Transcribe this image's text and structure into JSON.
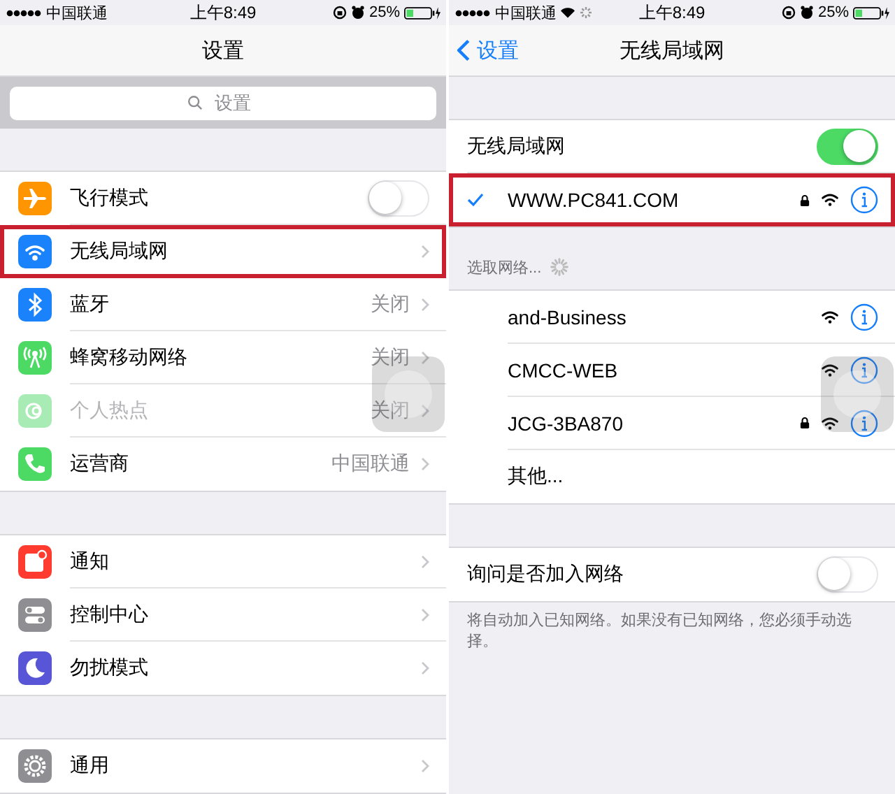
{
  "settings_screen": {
    "status_bar": {
      "carrier": "中国联通",
      "time": "上午8:49",
      "battery": "25%"
    },
    "nav": {
      "title": "设置"
    },
    "search": {
      "placeholder": "设置"
    },
    "groups": [
      [
        {
          "color": "#ff9500",
          "label": "飞行模式",
          "kind": "toggle",
          "on": false,
          "disabled": false,
          "highlighted": false
        },
        {
          "color": "#1a82fb",
          "label": "无线局域网",
          "kind": "link",
          "disabled": false,
          "highlighted": true
        },
        {
          "color": "#1a82fb",
          "label": "蓝牙",
          "value": "关闭",
          "kind": "link",
          "disabled": false,
          "highlighted": false
        },
        {
          "color": "#4cd964",
          "label": "蜂窝移动网络",
          "value": "关闭",
          "kind": "link",
          "disabled": false,
          "highlighted": false
        },
        {
          "color": "#a8ebb5",
          "label": "个人热点",
          "value": "关闭",
          "kind": "link",
          "disabled": true,
          "highlighted": false
        },
        {
          "color": "#4cd964",
          "label": "运营商",
          "value": "中国联通",
          "kind": "link",
          "disabled": false,
          "highlighted": false
        }
      ],
      [
        {
          "color": "#ff3b30",
          "label": "通知",
          "kind": "link",
          "disabled": false,
          "highlighted": false
        },
        {
          "color": "#8e8e93",
          "label": "控制中心",
          "kind": "link",
          "disabled": false,
          "highlighted": false
        },
        {
          "color": "#5856d6",
          "label": "勿扰模式",
          "kind": "link",
          "disabled": false,
          "highlighted": false
        }
      ],
      [
        {
          "color": "#8e8e93",
          "label": "通用",
          "kind": "link",
          "disabled": false,
          "highlighted": false
        }
      ]
    ]
  },
  "wifi_screen": {
    "status_bar": {
      "carrier": "中国联通",
      "wifi": true,
      "loading": true,
      "time": "上午8:49",
      "battery": "25%"
    },
    "nav": {
      "back": "设置",
      "title": "无线局域网"
    },
    "wifi_toggle": {
      "label": "无线局域网",
      "on": true
    },
    "current_network": {
      "name": "WWW.PC841.COM",
      "connected": true,
      "locked": true,
      "highlighted": true
    },
    "section_header": "选取网络...",
    "networks": [
      {
        "name": "and-Business",
        "locked": false,
        "kind": "network"
      },
      {
        "name": "CMCC-WEB",
        "locked": false,
        "kind": "network"
      },
      {
        "name": "JCG-3BA870",
        "locked": true,
        "kind": "network"
      },
      {
        "name": "其他...",
        "kind": "other"
      }
    ],
    "ask_to_join": {
      "label": "询问是否加入网络",
      "on": false
    },
    "footer": "将自动加入已知网络。如果没有已知网络，您必须手动选择。"
  }
}
